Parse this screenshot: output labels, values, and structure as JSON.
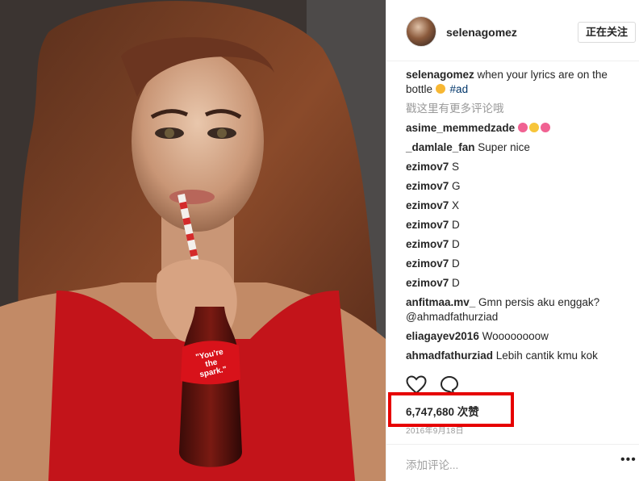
{
  "post": {
    "username": "selenagomez",
    "follow_label": "正在关注",
    "caption_user": "selenagomez",
    "caption_text": " when your lyrics are on the bottle ",
    "caption_tag": "#ad",
    "load_more": "戳这里有更多评论哦"
  },
  "comments": [
    {
      "user": "asime_memmedzade",
      "text": ""
    },
    {
      "user": "_damlale_fan",
      "text": " Super nice"
    },
    {
      "user": "ezimov7",
      "text": " S"
    },
    {
      "user": "ezimov7",
      "text": " G"
    },
    {
      "user": "ezimov7",
      "text": " X"
    },
    {
      "user": "ezimov7",
      "text": " D"
    },
    {
      "user": "ezimov7",
      "text": " D"
    },
    {
      "user": "ezimov7",
      "text": " D"
    },
    {
      "user": "ezimov7",
      "text": " D"
    },
    {
      "user": "anfitmaa.mv_",
      "text": " Gmn persis aku enggak? @ahmadfathurziad"
    },
    {
      "user": "eliagayev2016",
      "text": " Woooooooow"
    },
    {
      "user": "ahmadfathurziad",
      "text": " Lebih cantik kmu kok"
    }
  ],
  "likes": "6,747,680 次赞",
  "timestamp": "2016年9月18日",
  "add_comment_placeholder": "添加评论...",
  "more_options": "•••",
  "bottle_text": [
    "\"You're",
    "the",
    "spark.\""
  ],
  "colors": {
    "highlight": "#e60000",
    "link": "#003569",
    "muted": "#999999"
  },
  "icons": [
    "heart-icon",
    "comment-icon",
    "more-options-icon"
  ]
}
